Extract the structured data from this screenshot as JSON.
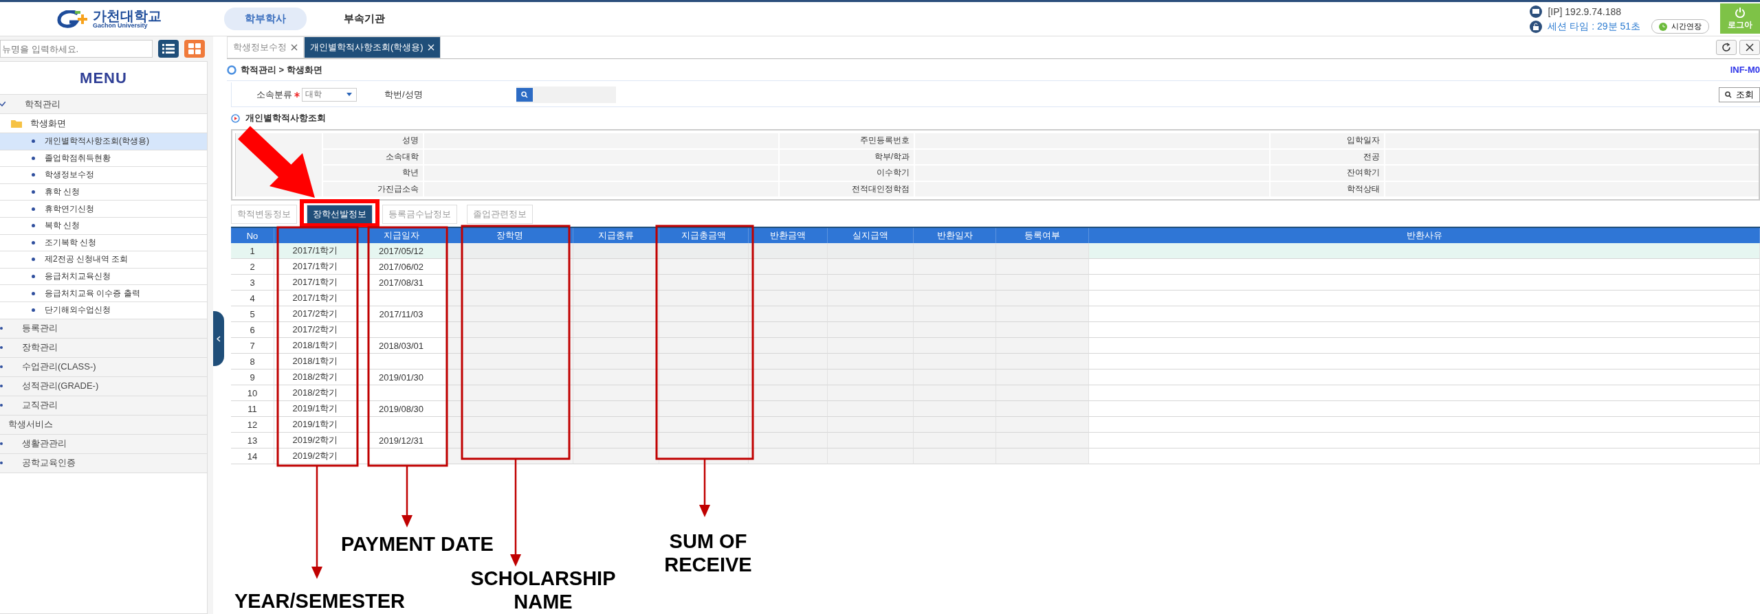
{
  "header": {
    "logo": {
      "name": "가천대학교",
      "subtitle": "Gachon University"
    },
    "nav": [
      {
        "label": "학부학사",
        "selected": true
      },
      {
        "label": "부속기관",
        "selected": false
      }
    ],
    "ip": "[IP] 192.9.74.188",
    "session": "세션 타임 : 29분 51초",
    "extend_button": "시간연장",
    "logout_button": "로그아"
  },
  "sidebar": {
    "search": {
      "placeholder": "뉴명을 입력하세요."
    },
    "title": "MENU",
    "menu": [
      {
        "label": "학적관리",
        "kind": "group",
        "children": [
          {
            "label": "학생화면",
            "children": [
              {
                "label": "개인별학적사항조회(학생용)",
                "selected": true
              },
              {
                "label": "졸업학점취득현황",
                "selected": false
              },
              {
                "label": "학생정보수정",
                "selected": false
              },
              {
                "label": "휴학 신청",
                "selected": false
              },
              {
                "label": "휴학연기신청",
                "selected": false
              },
              {
                "label": "복학 신청",
                "selected": false
              },
              {
                "label": "조기복학 신청",
                "selected": false
              },
              {
                "label": "제2전공 신청내역 조회",
                "selected": false
              },
              {
                "label": "응급처치교육신청",
                "selected": false
              },
              {
                "label": "응급처치교육 이수증 출력",
                "selected": false
              },
              {
                "label": "단기해외수업신청",
                "selected": false
              }
            ]
          }
        ]
      },
      {
        "label": "등록관리",
        "kind": "group"
      },
      {
        "label": "장학관리",
        "kind": "group"
      },
      {
        "label": "수업관리(CLASS-)",
        "kind": "group"
      },
      {
        "label": "성적관리(GRADE-)",
        "kind": "group"
      },
      {
        "label": "교직관리",
        "kind": "group"
      },
      {
        "label": "학생서비스",
        "kind": "section"
      },
      {
        "label": "생활관관리",
        "kind": "group"
      },
      {
        "label": "공학교육인증",
        "kind": "group"
      }
    ]
  },
  "tabs": [
    {
      "label": "학생정보수정",
      "selected": false
    },
    {
      "label": "개인별학적사항조회(학생용)",
      "selected": true
    }
  ],
  "breadcrumb": {
    "path": "학적관리 > 학생화면",
    "code": "INF-M0"
  },
  "search_form": {
    "category_label": "소속분류",
    "required": true,
    "category_value": "대학",
    "id_label": "학번/성명",
    "search_button": "조회"
  },
  "section_title": "개인별학적사항조회",
  "info_fields": [
    {
      "label": "성명"
    },
    {
      "label": "주민등록번호"
    },
    {
      "label": "입학일자"
    },
    {
      "label": "소속대학"
    },
    {
      "label": "학부/학과"
    },
    {
      "label": "전공"
    },
    {
      "label": "학년"
    },
    {
      "label": "이수학기"
    },
    {
      "label": "잔여학기"
    },
    {
      "label": "가진급소속"
    },
    {
      "label": "전적대인정학점"
    },
    {
      "label": "학적상태"
    }
  ],
  "sub_tabs": [
    {
      "label": "학적변동정보",
      "selected": false,
      "highlighted": false
    },
    {
      "label": "장학선발정보",
      "selected": true,
      "highlighted": true
    },
    {
      "label": "등록금수납정보",
      "selected": false,
      "highlighted": false
    },
    {
      "label": "졸업관련정보",
      "selected": false,
      "highlighted": false
    }
  ],
  "table": {
    "columns": [
      {
        "kind": "label",
        "label": "No"
      },
      {
        "kind": "blank"
      },
      {
        "kind": "label",
        "label": "지급일자"
      },
      {
        "kind": "label",
        "label": "장학명"
      },
      {
        "kind": "label",
        "label": "지급종류"
      },
      {
        "kind": "label",
        "label": "지급총금액"
      },
      {
        "kind": "label",
        "label": "반환금액"
      },
      {
        "kind": "label",
        "label": "실지급액"
      },
      {
        "kind": "label",
        "label": "반환일자"
      },
      {
        "kind": "label",
        "label": "등록여부"
      },
      {
        "kind": "label",
        "label": "반환사유"
      }
    ],
    "rows": [
      {
        "no": "1",
        "year_semester": "2017/1학기",
        "payment_date": "2017/05/12",
        "selected": true
      },
      {
        "no": "2",
        "year_semester": "2017/1학기",
        "payment_date": "2017/06/02",
        "selected": false
      },
      {
        "no": "3",
        "year_semester": "2017/1학기",
        "payment_date": "2017/08/31",
        "selected": false
      },
      {
        "no": "4",
        "year_semester": "2017/1학기",
        "selected": false
      },
      {
        "no": "5",
        "year_semester": "2017/2학기",
        "payment_date": "2017/11/03",
        "selected": false
      },
      {
        "no": "6",
        "year_semester": "2017/2학기",
        "selected": false
      },
      {
        "no": "7",
        "year_semester": "2018/1학기",
        "payment_date": "2018/03/01",
        "selected": false
      },
      {
        "no": "8",
        "year_semester": "2018/1학기",
        "selected": false
      },
      {
        "no": "9",
        "year_semester": "2018/2학기",
        "payment_date": "2019/01/30",
        "selected": false
      },
      {
        "no": "10",
        "year_semester": "2018/2학기",
        "selected": false
      },
      {
        "no": "11",
        "year_semester": "2019/1학기",
        "payment_date": "2019/08/30",
        "selected": false
      },
      {
        "no": "12",
        "year_semester": "2019/1학기",
        "selected": false
      },
      {
        "no": "13",
        "year_semester": "2019/2학기",
        "payment_date": "2019/12/31",
        "selected": false
      },
      {
        "no": "14",
        "year_semester": "2019/2학기",
        "selected": false
      }
    ]
  },
  "annotations": [
    {
      "label": "YEAR/SEMESTER"
    },
    {
      "label": "PAYMENT DATE"
    },
    {
      "label": "SCHOLARSHIP NAME"
    },
    {
      "label": "SUM OF RECEIVE"
    }
  ]
}
